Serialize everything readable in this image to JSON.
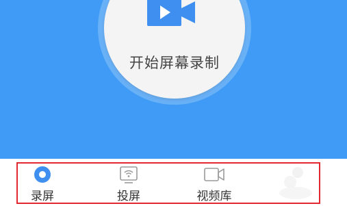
{
  "hero": {
    "record_button_label": "开始屏幕录制",
    "icon": "video-camera-icon",
    "background_color": "#3f9bf5",
    "icon_color": "#3f8ff0"
  },
  "tabbar": {
    "highlight_color": "#e0282e",
    "tabs": [
      {
        "label": "录屏",
        "icon": "record-dot-icon",
        "active": true
      },
      {
        "label": "投屏",
        "icon": "cast-screen-icon",
        "active": false
      },
      {
        "label": "视频库",
        "icon": "video-library-icon",
        "active": false
      }
    ]
  }
}
